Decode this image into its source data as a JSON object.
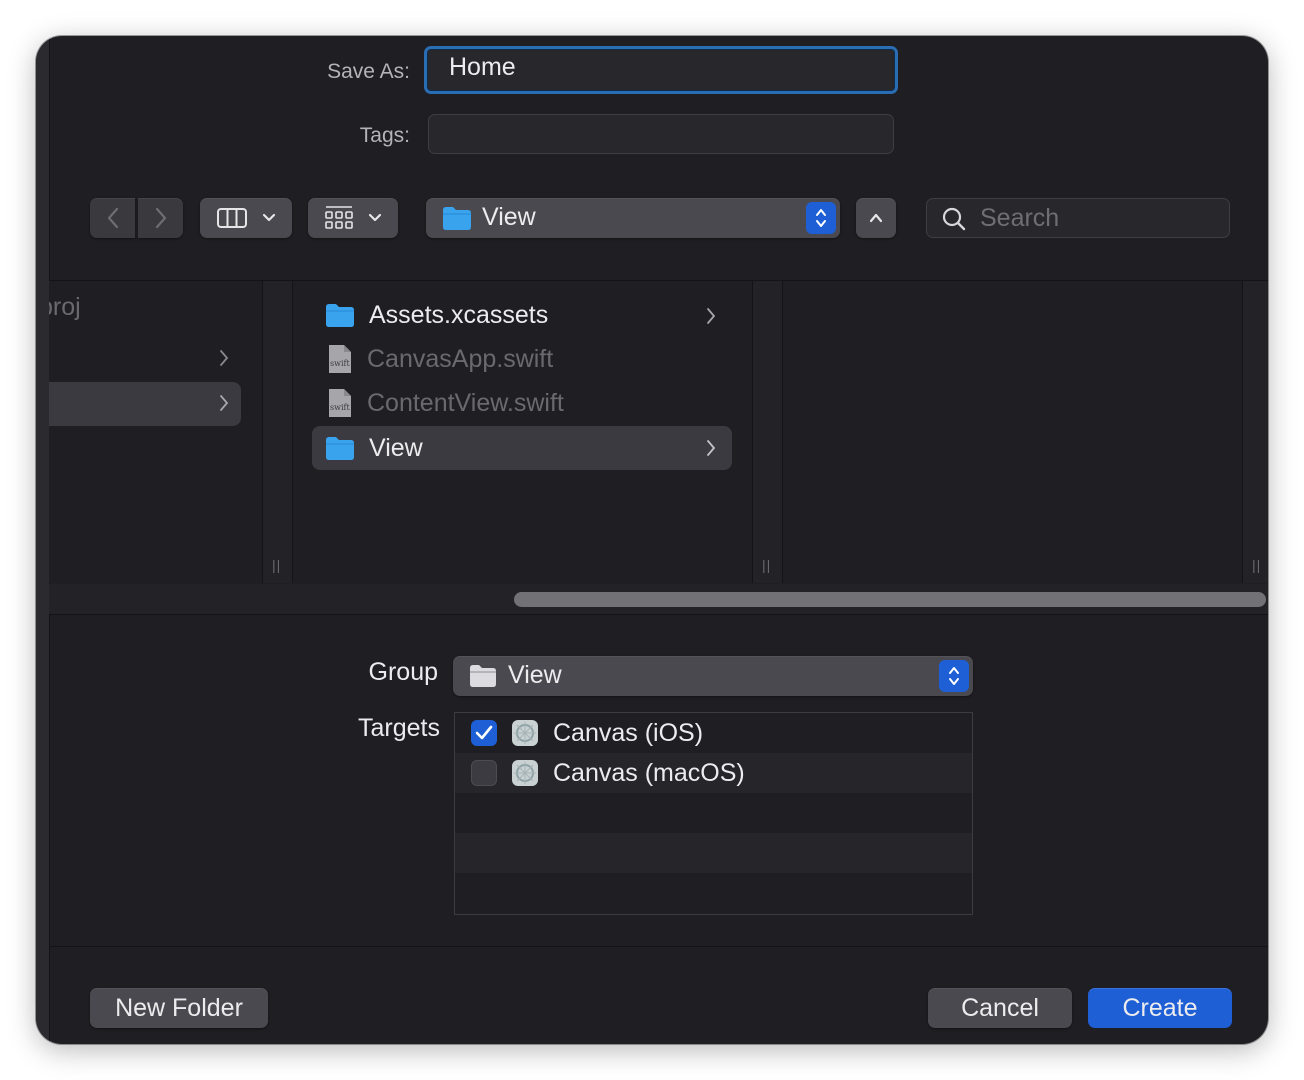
{
  "save_as": {
    "label": "Save As:",
    "value": "Home"
  },
  "tags": {
    "label": "Tags:",
    "value": ""
  },
  "toolbar": {
    "location": "View",
    "search_placeholder": "Search"
  },
  "browser": {
    "left_column_partial_text": "proj",
    "items": [
      {
        "name": "Assets.xcassets",
        "kind": "folder",
        "enabled": true,
        "selected": false,
        "has_children": true
      },
      {
        "name": "CanvasApp.swift",
        "kind": "swift-file",
        "enabled": false,
        "selected": false,
        "has_children": false
      },
      {
        "name": "ContentView.swift",
        "kind": "swift-file",
        "enabled": false,
        "selected": false,
        "has_children": false
      },
      {
        "name": "View",
        "kind": "folder",
        "enabled": true,
        "selected": true,
        "has_children": true
      }
    ],
    "file_badge": "swift"
  },
  "group": {
    "label": "Group",
    "value": "View"
  },
  "targets": {
    "label": "Targets",
    "items": [
      {
        "name": "Canvas (iOS)",
        "checked": true
      },
      {
        "name": "Canvas (macOS)",
        "checked": false
      }
    ]
  },
  "buttons": {
    "new_folder": "New Folder",
    "cancel": "Cancel",
    "create": "Create"
  },
  "icons": {
    "back": "chevron-left-icon",
    "forward": "chevron-right-icon",
    "columns": "column-view-icon",
    "grid": "icon-grid-icon",
    "folder": "folder-icon",
    "popup": "up-down-chevron-icon",
    "expand": "chevron-up-icon",
    "search": "magnifier-icon",
    "check": "checkmark-icon",
    "target": "app-target-icon"
  },
  "colors": {
    "accent": "#1e5fd6",
    "focus_ring": "#2b6db3",
    "window_bg": "#1f1e22",
    "folder": "#3aa3ee"
  }
}
